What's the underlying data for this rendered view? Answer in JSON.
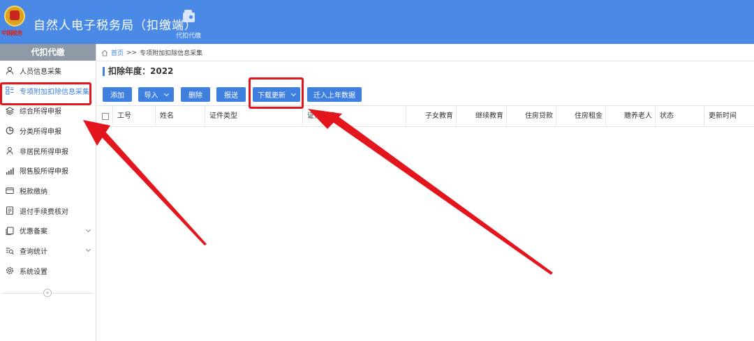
{
  "header": {
    "emblem_text": "中国税务",
    "title": "自然人电子税务局（扣缴端）",
    "nav_label": "代扣代缴"
  },
  "sidebar": {
    "heading": "代扣代缴",
    "items": [
      {
        "label": "人员信息采集",
        "icon": "person-icon"
      },
      {
        "label": "专项附加扣除信息采集",
        "icon": "grid-list-icon",
        "active": true
      },
      {
        "label": "综合所得申报",
        "icon": "layers-icon"
      },
      {
        "label": "分类所得申报",
        "icon": "pie-chart-icon"
      },
      {
        "label": "非居民所得申报",
        "icon": "person-outline-icon"
      },
      {
        "label": "限售股所得申报",
        "icon": "bar-chart-icon"
      },
      {
        "label": "税款缴纳",
        "icon": "wallet-icon"
      },
      {
        "label": "退付手续费核对",
        "icon": "document-icon"
      },
      {
        "label": "优惠备案",
        "icon": "copy-icon",
        "expandable": true
      },
      {
        "label": "查询统计",
        "icon": "search-list-icon",
        "expandable": true
      },
      {
        "label": "系统设置",
        "icon": "gear-icon"
      }
    ],
    "collapse_glyph": "«"
  },
  "breadcrumb": {
    "home": "首页",
    "separator": ">>",
    "current": "专项附加扣除信息采集"
  },
  "deduction_year": "扣除年度：2022",
  "toolbar": {
    "add": "添加",
    "import": "导入",
    "delete": "删除",
    "submit": "报送",
    "download_update": "下载更新",
    "migrate_last_year": "迁入上年数据"
  },
  "table": {
    "columns": [
      "工号",
      "姓名",
      "证件类型",
      "证件号码",
      "子女教育",
      "继续教育",
      "住房贷款",
      "住房租金",
      "赡养老人",
      "状态",
      "更新时间"
    ]
  },
  "colors": {
    "header_bg": "#4a8ae6",
    "primary": "#3e7fe0",
    "annotation_red": "#e4161d"
  }
}
